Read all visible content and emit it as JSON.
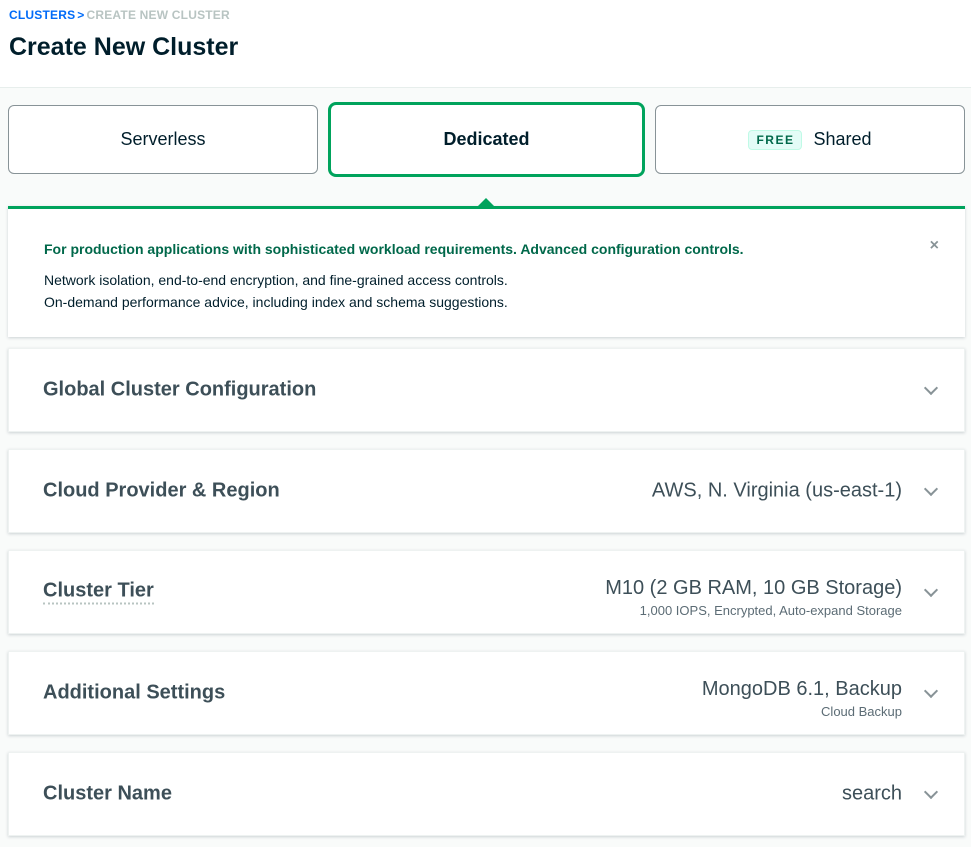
{
  "breadcrumb": {
    "parent": "CLUSTERS",
    "separator": ">",
    "current": "CREATE NEW CLUSTER"
  },
  "page_title": "Create New Cluster",
  "cluster_types": {
    "serverless": "Serverless",
    "dedicated": "Dedicated",
    "shared": "Shared",
    "shared_badge": "FREE",
    "selected": "dedicated"
  },
  "info_panel": {
    "headline": "For production applications with sophisticated workload requirements. Advanced configuration controls.",
    "line_1": "Network isolation, end-to-end encryption, and fine-grained access controls.",
    "line_2": "On-demand performance advice, including index and schema suggestions.",
    "dismiss": "×"
  },
  "sections": {
    "global": {
      "title": "Global Cluster Configuration"
    },
    "cloud": {
      "title": "Cloud Provider & Region",
      "value": "AWS, N. Virginia (us-east-1)"
    },
    "tier": {
      "title": "Cluster Tier",
      "value": "M10 (2 GB RAM, 10 GB Storage)",
      "sub": "1,000 IOPS, Encrypted, Auto-expand Storage"
    },
    "additional": {
      "title": "Additional Settings",
      "value": "MongoDB 6.1, Backup",
      "sub": "Cloud Backup"
    },
    "name": {
      "title": "Cluster Name",
      "value": "search"
    }
  },
  "colors": {
    "accent_green": "#00a35c",
    "dark_green": "#00684a",
    "link_blue": "#016bf8"
  }
}
